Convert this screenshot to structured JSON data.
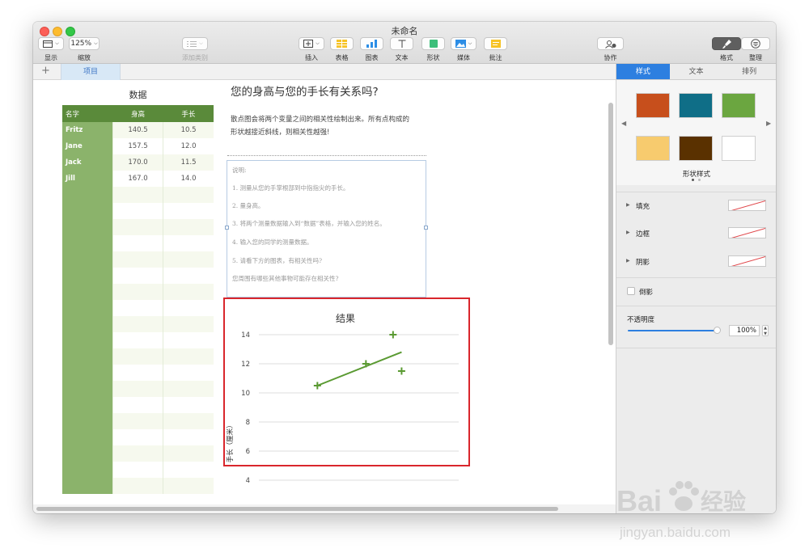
{
  "window": {
    "title": "未命名"
  },
  "toolbar": {
    "view": {
      "label": "显示"
    },
    "zoom": {
      "value": "125%",
      "label": "缩放"
    },
    "add_category": {
      "label": "添加类别"
    },
    "insert": {
      "label": "插入"
    },
    "table": {
      "label": "表格"
    },
    "chart": {
      "label": "图表"
    },
    "text": {
      "label": "文本"
    },
    "shape": {
      "label": "形状"
    },
    "media": {
      "label": "媒体"
    },
    "comment": {
      "label": "批注"
    },
    "collaborate": {
      "label": "协作"
    },
    "format": {
      "label": "格式"
    },
    "organize": {
      "label": "整理"
    }
  },
  "sheets": {
    "add": "+",
    "tabs": [
      {
        "label": "项目"
      }
    ]
  },
  "table": {
    "title": "数据",
    "headers": [
      "名字",
      "身高",
      "手长"
    ],
    "rows": [
      [
        "Fritz",
        "140.5",
        "10.5"
      ],
      [
        "Jane",
        "157.5",
        "12.0"
      ],
      [
        "Jack",
        "170.0",
        "11.5"
      ],
      [
        "Jill",
        "167.0",
        "14.0"
      ]
    ]
  },
  "question": {
    "title": "您的身高与您的手长有关系吗?",
    "description_line1": "散点图会将两个变量之间的相关性绘制出来。所有点构成的",
    "description_line2": "形状越接近斜线，则相关性越强!"
  },
  "notes": {
    "heading": "说明:",
    "items": [
      "1.  测量从您的手掌根部到中指指尖的手长。",
      "2.  量身高。",
      "3.  将两个测量数据输入到“数据”表格，并输入您的姓名。",
      "4.  输入您的同学的测量数据。",
      "5.  请看下方的图表，有相关性吗?"
    ],
    "footer": "您周围有哪些其他事物可能存在相关性?"
  },
  "chart_data": {
    "type": "scatter",
    "title": "结果",
    "ylabel": "手长（厘米）",
    "xlabel": "",
    "ylim": [
      4,
      14
    ],
    "yticks": [
      14,
      12,
      10,
      8,
      6,
      4
    ],
    "grid": true,
    "marker": "+",
    "color": "#5a9a32",
    "points": [
      {
        "x": 140.5,
        "y": 10.5
      },
      {
        "x": 157.5,
        "y": 12.0
      },
      {
        "x": 170.0,
        "y": 11.5
      },
      {
        "x": 167.0,
        "y": 14.0
      }
    ],
    "trendline": {
      "x": [
        140.5,
        170.0
      ],
      "y": [
        10.5,
        12.8
      ]
    }
  },
  "inspector": {
    "tabs": [
      "样式",
      "文本",
      "排列"
    ],
    "active_tab": "样式",
    "shape_styles": {
      "caption": "形状样式",
      "swatches": [
        "#c74f1c",
        "#0f6e87",
        "#6ba640",
        "#f7cb6e",
        "#5a3100",
        "#ffffff"
      ]
    },
    "fill": {
      "label": "填充"
    },
    "border": {
      "label": "边框"
    },
    "shadow": {
      "label": "阴影"
    },
    "reflection": {
      "label": "倒影"
    },
    "opacity": {
      "label": "不透明度",
      "value": "100%",
      "level": 1.0
    }
  },
  "watermark": {
    "brand": "Bai",
    "brand2": "经验",
    "url": "jingyan.baidu.com"
  },
  "colors": {
    "accent": "#2d7fe0",
    "highlight": "#d9262c",
    "table_header": "#5a8a3a"
  }
}
